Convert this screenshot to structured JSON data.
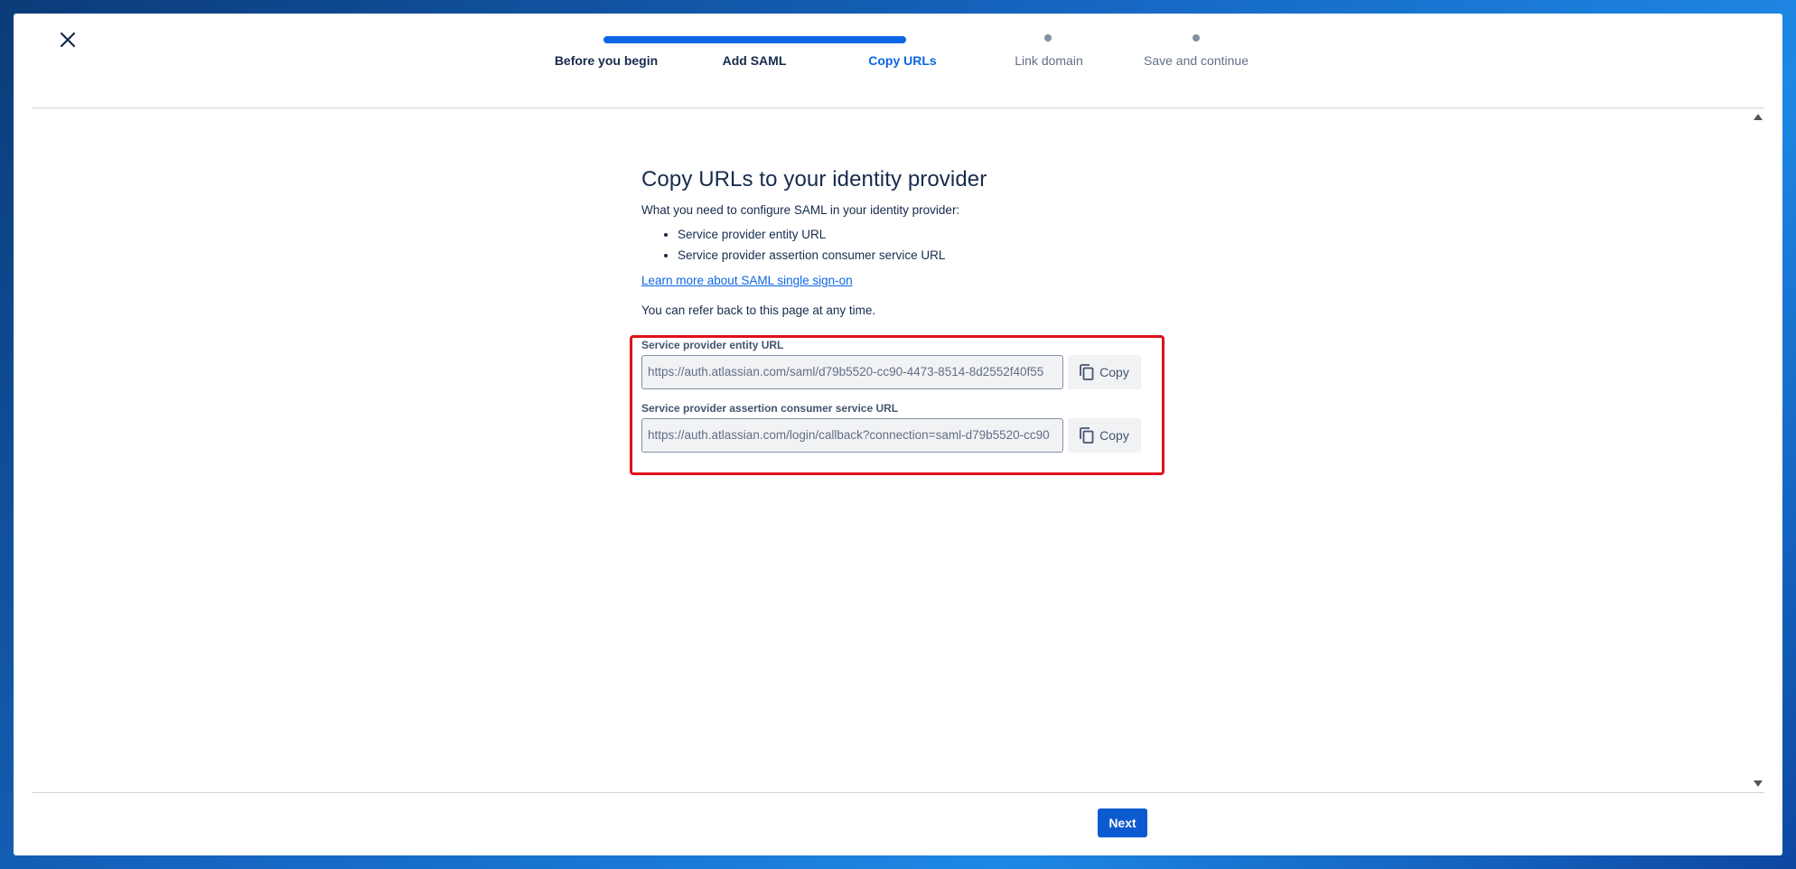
{
  "stepper": {
    "steps": [
      {
        "label": "Before you begin",
        "state": "done"
      },
      {
        "label": "Add SAML",
        "state": "done"
      },
      {
        "label": "Copy URLs",
        "state": "current"
      },
      {
        "label": "Link domain",
        "state": "future"
      },
      {
        "label": "Save and continue",
        "state": "future"
      }
    ]
  },
  "main": {
    "title": "Copy URLs to your identity provider",
    "intro": "What you need to configure SAML in your identity provider:",
    "bullets": [
      "Service provider entity URL",
      "Service provider assertion consumer service URL"
    ],
    "learn_link": "Learn more about SAML single sign-on",
    "refer_text": "You can refer back to this page at any time."
  },
  "fields": [
    {
      "label": "Service provider entity URL",
      "value": "https://auth.atlassian.com/saml/d79b5520-cc90-4473-8514-8d2552f40f55",
      "copy_label": "Copy"
    },
    {
      "label": "Service provider assertion consumer service URL",
      "value": "https://auth.atlassian.com/login/callback?connection=saml-d79b5520-cc90",
      "copy_label": "Copy"
    }
  ],
  "footer": {
    "next_label": "Next"
  },
  "colors": {
    "primary": "#0c66e4",
    "highlight": "#e0111c",
    "text": "#172b4d"
  }
}
